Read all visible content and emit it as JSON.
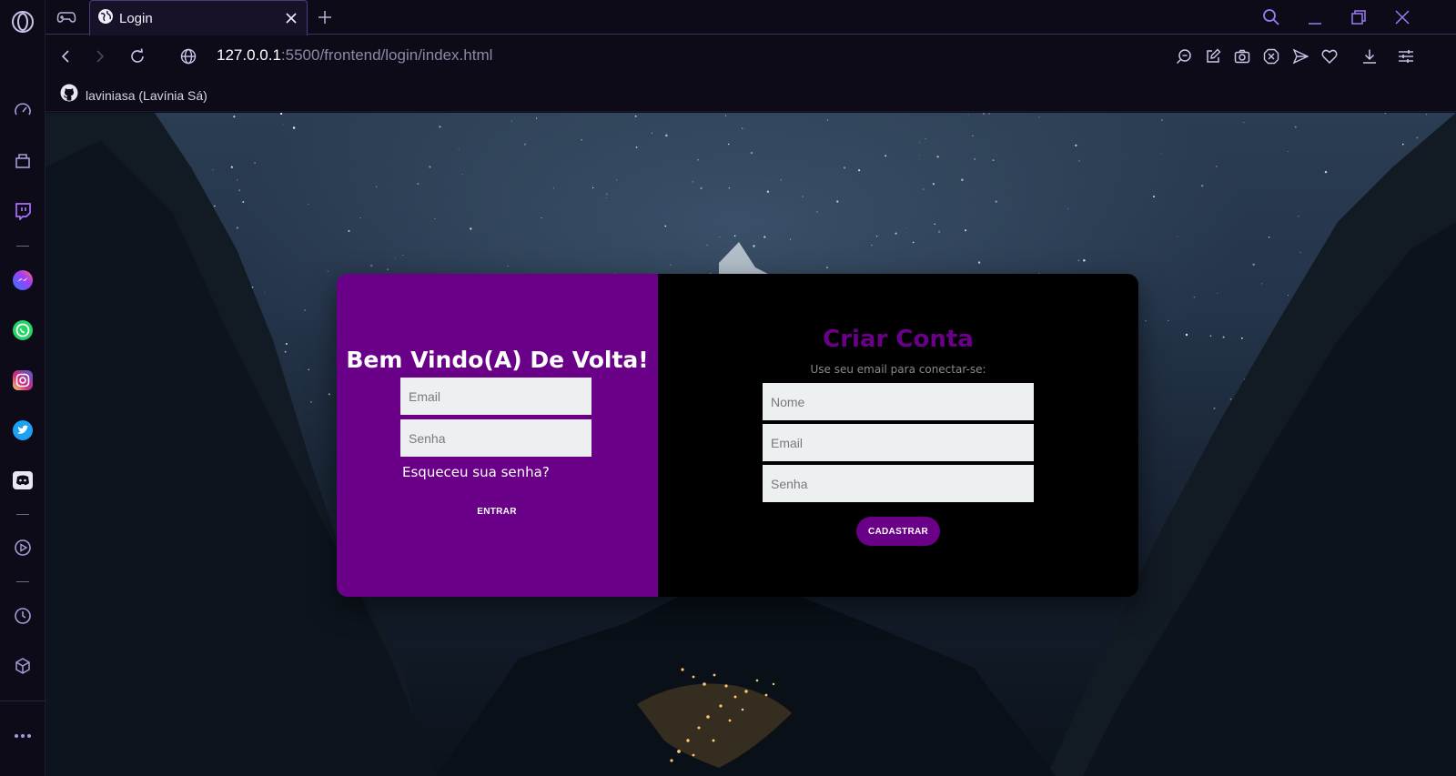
{
  "browser": {
    "tab_title": "Login",
    "url_host": "127.0.0.1",
    "url_path": ":5500/frontend/login/index.html",
    "bookmark_label": "laviniasa (Lavínia Sá)",
    "accent": "#8a5cf6"
  },
  "sidebar": {
    "icons": [
      "speed-dial-icon",
      "workspaces-icon",
      "twitch-icon",
      "messenger-icon",
      "whatsapp-icon",
      "instagram-icon",
      "twitter-icon",
      "discord-icon",
      "player-icon",
      "history-icon",
      "extensions-icon",
      "more-icon"
    ]
  },
  "login": {
    "heading": "Bem Vindo(A) De Volta!",
    "email_placeholder": "Email",
    "password_placeholder": "Senha",
    "forgot_label": "Esqueceu sua senha?",
    "submit_label": "ENTRAR",
    "panel_color": "#6a0088"
  },
  "signup": {
    "heading": "Criar Conta",
    "subtitle": "Use seu email para conectar-se:",
    "name_placeholder": "Nome",
    "email_placeholder": "Email",
    "password_placeholder": "Senha",
    "submit_label": "CADASTRAR",
    "panel_color": "#000000"
  }
}
